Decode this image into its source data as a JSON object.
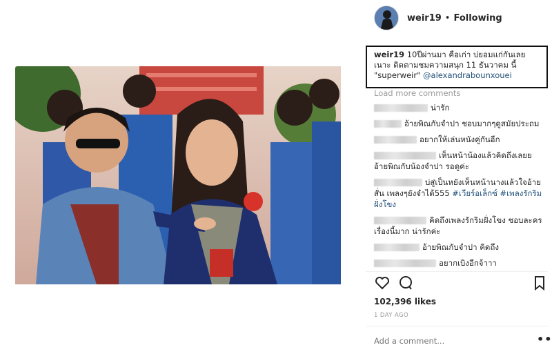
{
  "post": {
    "username": "weir19",
    "separator": "•",
    "follow_status": "Following",
    "caption_user": "weir19",
    "caption_text": "10ปีผ่านมา คือเก่า บ่ยอมแก่กันเลย เนาะ ติดตามชมความสนุก 11 ธันวาคม นี้ \"superweir\"",
    "caption_mention": "@alexandrabounxouei",
    "load_more": "Load more comments",
    "likes": "102,396 likes",
    "time_ago": "1 DAY AGO",
    "add_comment_placeholder": "Add a comment...",
    "more_options": "•••"
  },
  "comments": [
    {
      "text": "น่ารัก"
    },
    {
      "text": "อ้ายพิณกับจำปา ชอบมากๆดูสมัยประถม"
    },
    {
      "text": "อยากให้เล่นหนังคู่กันอีก"
    },
    {
      "text": "เห็นหน้าน้องแล้วคิดถึงเลยย อ้ายพิณกับน้องจำปา รอดูค่ะ"
    },
    {
      "text": "บ่สู่เป็นหยังเห็นหน้านางแล้วใจอ้ายสั่น เพลงๆยังจำได้555",
      "hashtags": "#เวียร์อเล็กซ์ #เพลงรักริมฝั่งโขง"
    },
    {
      "text": "คิดถึงเพลงรักริมฝั่งโขง ชอบละครเรื่องนี้มาก น่ารักค่ะ"
    },
    {
      "text": "อ้ายพิณกับจำปา คิดถึง"
    },
    {
      "text": "อยากเบิงอีกจ้าาา"
    }
  ],
  "icons": {
    "like": "heart-icon",
    "comment": "comment-icon",
    "save": "bookmark-icon"
  },
  "colors": {
    "link": "#1f4e79",
    "muted": "#999999",
    "text": "#262626"
  }
}
